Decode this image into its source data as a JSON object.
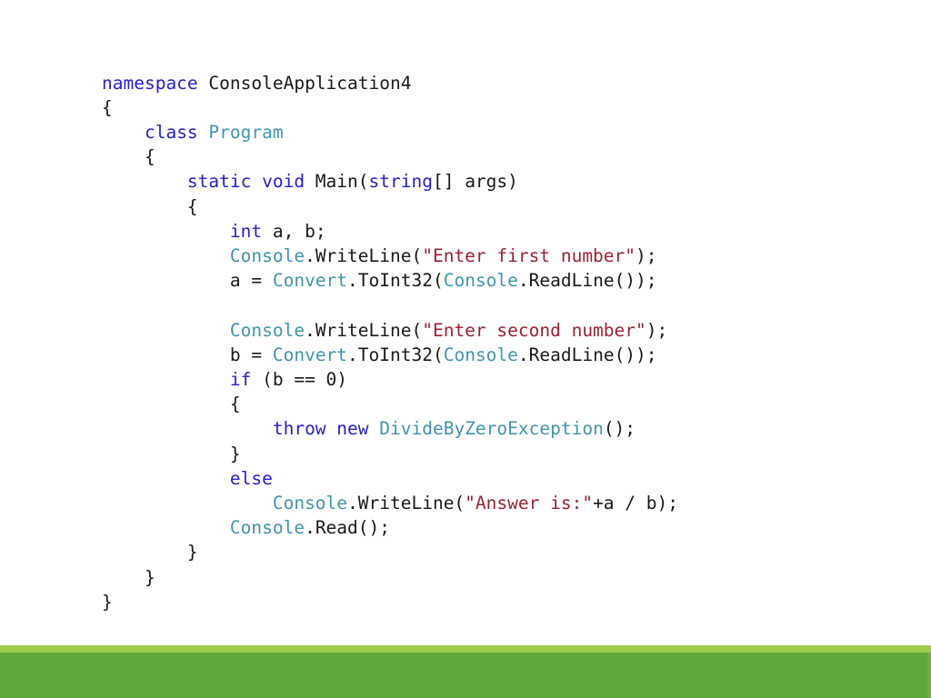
{
  "slide": {
    "background_color": "#ffffff",
    "footer": {
      "light_band_color": "#9ECB4A",
      "main_band_color": "#60A839",
      "edge_color": "#6EAE45"
    }
  },
  "code": {
    "language": "csharp",
    "colors": {
      "keyword": "#2A20CF",
      "type": "#4096B0",
      "string": "#9E2233",
      "plain": "#1a1a1a"
    },
    "lines": [
      {
        "indent": 0,
        "tokens": [
          {
            "t": "kw",
            "s": "namespace"
          },
          {
            "t": "pln",
            "s": " ConsoleApplication4"
          }
        ]
      },
      {
        "indent": 0,
        "tokens": [
          {
            "t": "pln",
            "s": "{"
          }
        ]
      },
      {
        "indent": 1,
        "tokens": [
          {
            "t": "kw",
            "s": "class"
          },
          {
            "t": "pln",
            "s": " "
          },
          {
            "t": "type",
            "s": "Program"
          }
        ]
      },
      {
        "indent": 1,
        "tokens": [
          {
            "t": "pln",
            "s": "{"
          }
        ]
      },
      {
        "indent": 2,
        "tokens": [
          {
            "t": "kw",
            "s": "static void"
          },
          {
            "t": "pln",
            "s": " Main("
          },
          {
            "t": "kw",
            "s": "string"
          },
          {
            "t": "pln",
            "s": "[] args)"
          }
        ]
      },
      {
        "indent": 2,
        "tokens": [
          {
            "t": "pln",
            "s": "{"
          }
        ]
      },
      {
        "indent": 3,
        "tokens": [
          {
            "t": "kw",
            "s": "int"
          },
          {
            "t": "pln",
            "s": " a, b;"
          }
        ]
      },
      {
        "indent": 3,
        "tokens": [
          {
            "t": "type",
            "s": "Console"
          },
          {
            "t": "pln",
            "s": ".WriteLine("
          },
          {
            "t": "str",
            "s": "\"Enter first number\""
          },
          {
            "t": "pln",
            "s": ");"
          }
        ]
      },
      {
        "indent": 3,
        "tokens": [
          {
            "t": "pln",
            "s": "a = "
          },
          {
            "t": "type",
            "s": "Convert"
          },
          {
            "t": "pln",
            "s": ".ToInt32("
          },
          {
            "t": "type",
            "s": "Console"
          },
          {
            "t": "pln",
            "s": ".ReadLine());"
          }
        ]
      },
      {
        "indent": 0,
        "blank": true,
        "tokens": []
      },
      {
        "indent": 3,
        "tokens": [
          {
            "t": "type",
            "s": "Console"
          },
          {
            "t": "pln",
            "s": ".WriteLine("
          },
          {
            "t": "str",
            "s": "\"Enter second number\""
          },
          {
            "t": "pln",
            "s": ");"
          }
        ]
      },
      {
        "indent": 3,
        "tokens": [
          {
            "t": "pln",
            "s": "b = "
          },
          {
            "t": "type",
            "s": "Convert"
          },
          {
            "t": "pln",
            "s": ".ToInt32("
          },
          {
            "t": "type",
            "s": "Console"
          },
          {
            "t": "pln",
            "s": ".ReadLine());"
          }
        ]
      },
      {
        "indent": 3,
        "tokens": [
          {
            "t": "kw",
            "s": "if"
          },
          {
            "t": "pln",
            "s": " (b == 0)"
          }
        ]
      },
      {
        "indent": 3,
        "tokens": [
          {
            "t": "pln",
            "s": "{"
          }
        ]
      },
      {
        "indent": 4,
        "tokens": [
          {
            "t": "kw",
            "s": "throw new"
          },
          {
            "t": "pln",
            "s": " "
          },
          {
            "t": "type",
            "s": "DivideByZeroException"
          },
          {
            "t": "pln",
            "s": "();"
          }
        ]
      },
      {
        "indent": 3,
        "tokens": [
          {
            "t": "pln",
            "s": "}"
          }
        ]
      },
      {
        "indent": 3,
        "tokens": [
          {
            "t": "kw",
            "s": "else"
          }
        ]
      },
      {
        "indent": 4,
        "tokens": [
          {
            "t": "type",
            "s": "Console"
          },
          {
            "t": "pln",
            "s": ".WriteLine("
          },
          {
            "t": "str",
            "s": "\"Answer is:\""
          },
          {
            "t": "pln",
            "s": "+a / b);"
          }
        ]
      },
      {
        "indent": 3,
        "tokens": [
          {
            "t": "type",
            "s": "Console"
          },
          {
            "t": "pln",
            "s": ".Read();"
          }
        ]
      },
      {
        "indent": 2,
        "tokens": [
          {
            "t": "pln",
            "s": "}"
          }
        ]
      },
      {
        "indent": 1,
        "tokens": [
          {
            "t": "pln",
            "s": "}"
          }
        ]
      },
      {
        "indent": 0,
        "tokens": [
          {
            "t": "pln",
            "s": "}"
          }
        ]
      }
    ]
  }
}
